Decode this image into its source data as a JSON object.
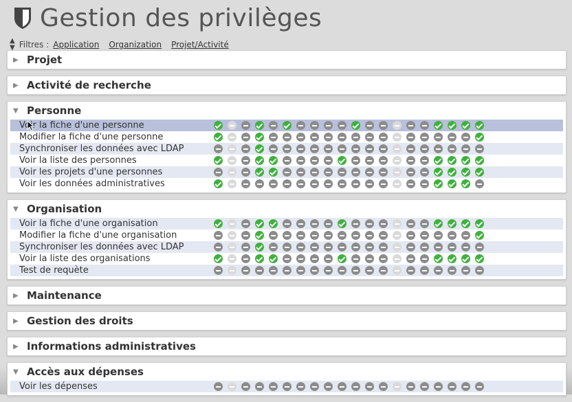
{
  "page_title": "Gestion des privilèges",
  "filters": {
    "label": "Filtres :",
    "links": [
      "Application",
      "Organization",
      "Projet/Activité"
    ]
  },
  "sections": [
    {
      "title": "Projet",
      "expanded": false,
      "rows": []
    },
    {
      "title": "Activité de recherche",
      "expanded": false,
      "rows": []
    },
    {
      "title": "Personne",
      "expanded": true,
      "rows": [
        {
          "label": "Voir la fiche d'une personne",
          "states": "pxnpnpnnnnpnnxnnpppp"
        },
        {
          "label": "Modifier la fiche d'une personne",
          "states": "pxnpnnnnnnnnnxnnnnnp"
        },
        {
          "label": "Synchroniser les données avec LDAP",
          "states": "nxnpnnnnnnnnnxnnnnnn"
        },
        {
          "label": "Voir la liste des personnes",
          "states": "pxnppnnnnpnnnxnnpppp"
        },
        {
          "label": "Voir les projets d'une personnes",
          "states": "nxnppnnnnnnnnxnnpppp"
        },
        {
          "label": "Voir les données administratives",
          "states": "pxnnnnnnnnnnnxnnpppn"
        }
      ]
    },
    {
      "title": "Organisation",
      "expanded": true,
      "rows": [
        {
          "label": "Voir la fiche d'une organisation",
          "states": "pxnppnnnnpnnnxnnpppp"
        },
        {
          "label": "Modifier la fiche d'une organisation",
          "states": "nxnpnnnnnnnnnxnnnnnp"
        },
        {
          "label": "Synchroniser les données avec LDAP",
          "states": "nxnpnnnnnnnnnxnnnnnn"
        },
        {
          "label": "Voir la liste des organisations",
          "states": "pxnppnnnnpnnnxnnpppp"
        },
        {
          "label": "Test de requète",
          "states": "nxnnnnnnnnnnnxnnnnnn"
        }
      ]
    },
    {
      "title": "Maintenance",
      "expanded": false,
      "rows": []
    },
    {
      "title": "Gestion des droits",
      "expanded": false,
      "rows": []
    },
    {
      "title": "Informations administratives",
      "expanded": false,
      "rows": []
    },
    {
      "title": "Accès aux dépenses",
      "expanded": true,
      "rows": [
        {
          "label": "Voir les dépenses",
          "states": "nxnnnnnnnnnnnxnnnnnn"
        }
      ]
    }
  ],
  "legend": {
    "p": "granted",
    "n": "denied",
    "x": "disabled"
  },
  "colors": {
    "granted": "#3fb13d",
    "denied": "#8c8c8c",
    "disabled": "#dadada",
    "row_alt": "#e4e8f2",
    "row_hover": "#b8c0db"
  }
}
